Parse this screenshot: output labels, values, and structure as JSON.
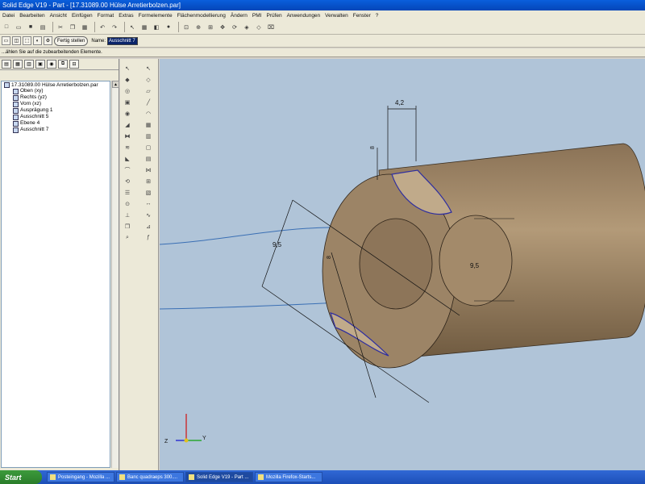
{
  "window": {
    "title": "Solid Edge V19 - Part - [17.31089.00 Hülse Arretierbolzen.par]"
  },
  "menu": [
    "Datei",
    "Bearbeiten",
    "Ansicht",
    "Einfügen",
    "Format",
    "Extras",
    "Formelemente",
    "Flächenmodellierung",
    "Ändern",
    "PMI",
    "Prüfen",
    "Anwendungen",
    "Verwalten",
    "Fenster",
    "?"
  ],
  "ribbon": {
    "finish_label": "Fertig stellen",
    "name_label": "Name:",
    "name_value": "Ausschnitt 7"
  },
  "prompt": "...ählen Sie auf die zubearbeitenden Elemente.",
  "tree": {
    "root": "17.31089.00 Hülse Arretierbolzen.par",
    "items": [
      "Oben (xy)",
      "Rechts (yz)",
      "Vorn (xz)",
      "Ausprägung 1",
      "Ausschnitt 5",
      "Ebene 4",
      "Ausschnitt 7"
    ]
  },
  "dimensions": {
    "d1": "4,2",
    "d2": "8",
    "d3": "9,5",
    "d4": "8",
    "d5": "9,5"
  },
  "axes": {
    "z": "Z",
    "y": "Y"
  },
  "taskbar": {
    "start": "Start",
    "items": [
      "Posteingang - Mozilla ...",
      "Banc quadraeps 300....",
      "Solid Edge V19 - Part ...",
      "Mozilla Firefox-Starts..."
    ]
  },
  "colors": {
    "viewport": "#b0c4d8",
    "part": "#a48a68",
    "titlebar": "#0a5fdc"
  }
}
